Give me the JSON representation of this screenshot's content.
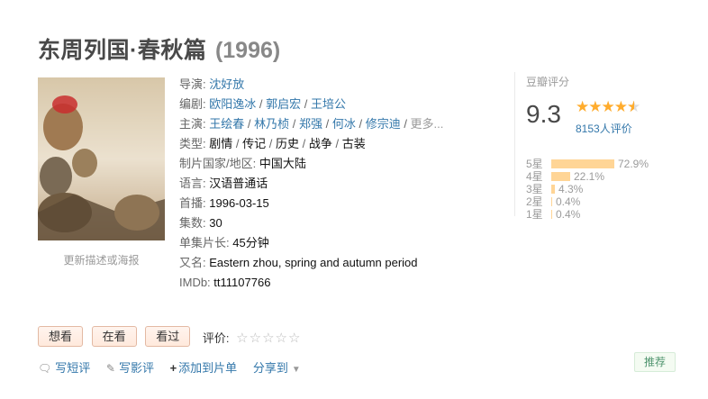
{
  "title": {
    "main": "东周列国·春秋篇",
    "year": "(1996)"
  },
  "poster": {
    "update_text": "更新描述或海报"
  },
  "info": {
    "director": {
      "label": "导演:",
      "names": [
        "沈好放"
      ]
    },
    "writers": {
      "label": "编剧:",
      "names": [
        "欧阳逸冰",
        "郭启宏",
        "王培公"
      ]
    },
    "cast": {
      "label": "主演:",
      "names": [
        "王绘春",
        "林乃桢",
        "郑强",
        "何冰",
        "修宗迪"
      ],
      "more": "更多..."
    },
    "genre": {
      "label": "类型:",
      "values": [
        "剧情",
        "传记",
        "历史",
        "战争",
        "古装"
      ]
    },
    "country": {
      "label": "制片国家/地区:",
      "value": "中国大陆"
    },
    "language": {
      "label": "语言:",
      "value": "汉语普通话"
    },
    "premiere": {
      "label": "首播:",
      "value": "1996-03-15"
    },
    "episodes": {
      "label": "集数:",
      "value": "30"
    },
    "runtime": {
      "label": "单集片长:",
      "value": "45分钟"
    },
    "aka": {
      "label": "又名:",
      "value": "Eastern zhou, spring and autumn period"
    },
    "imdb": {
      "label": "IMDb:",
      "value": "tt11107766"
    }
  },
  "rating": {
    "label": "豆瓣评分",
    "score": "9.3",
    "stars_value": 4.5,
    "count": "8153人评价",
    "distribution": [
      {
        "label": "5星",
        "percent": "72.9%",
        "value": 72.9
      },
      {
        "label": "4星",
        "percent": "22.1%",
        "value": 22.1
      },
      {
        "label": "3星",
        "percent": "4.3%",
        "value": 4.3
      },
      {
        "label": "2星",
        "percent": "0.4%",
        "value": 0.4
      },
      {
        "label": "1星",
        "percent": "0.4%",
        "value": 0.4
      }
    ]
  },
  "actions": {
    "want": "想看",
    "watching": "在看",
    "watched": "看过",
    "rate_label": "评价:",
    "my_stars": "☆☆☆☆☆"
  },
  "links": {
    "short_review": "写短评",
    "review": "写影评",
    "add_list": "添加到片单",
    "share": "分享到",
    "recommend": "推荐"
  },
  "colors": {
    "link": "#3377aa",
    "star": "#ffac2d",
    "bar": "#ffd596",
    "recommend": "#4f946e"
  }
}
